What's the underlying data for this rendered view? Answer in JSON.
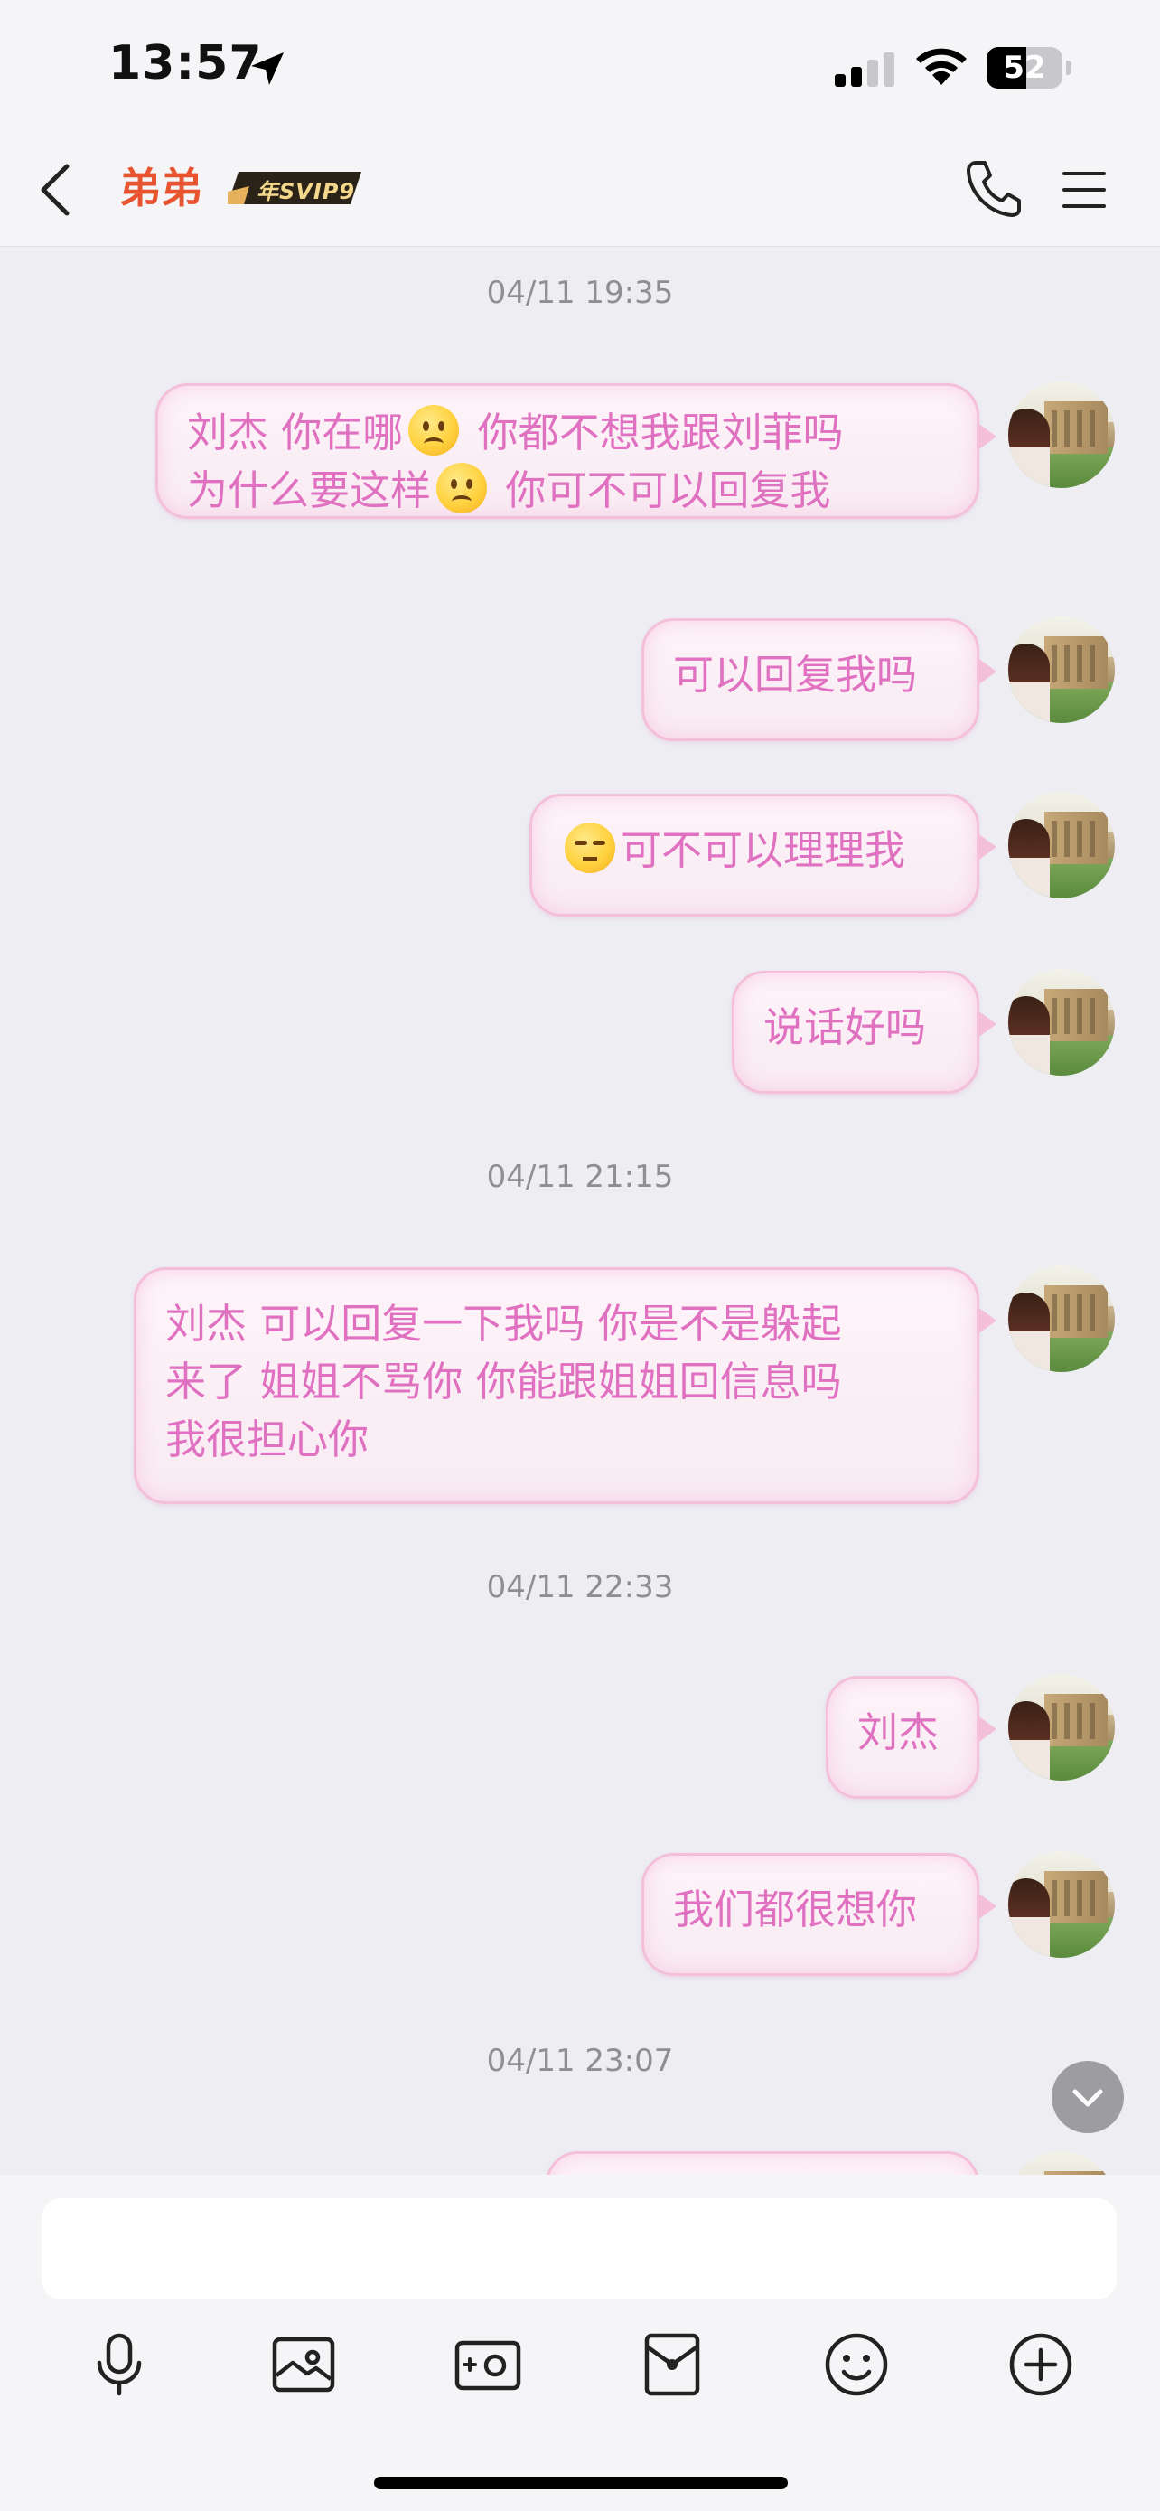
{
  "status_bar": {
    "time": "13:57",
    "battery_level": "52",
    "battery_fraction": 0.52
  },
  "header": {
    "title": "弟弟",
    "vip_badge": "年SVIP9",
    "back_icon": "chevron-left-icon",
    "call_icon": "phone-icon",
    "menu_icon": "menu-icon"
  },
  "messages": [
    {
      "type": "time",
      "text": "04/11 19:35"
    },
    {
      "type": "msg",
      "text_1": "刘杰 你在哪",
      "emoji_1": "slightly-frowning-face",
      "text_2": " 你都不想我跟刘菲吗\n为什么要这样",
      "emoji_2": "slightly-frowning-face",
      "text_3": " 你可不可以回复我"
    },
    {
      "type": "msg",
      "text": "可以回复我吗"
    },
    {
      "type": "msg",
      "emoji": "unamused-face",
      "text": "可不可以理理我"
    },
    {
      "type": "msg",
      "text": "说话好吗"
    },
    {
      "type": "time",
      "text": "04/11 21:15"
    },
    {
      "type": "msg",
      "text": "刘杰 可以回复一下我吗 你是不是躲起\n来了 姐姐不骂你 你能跟姐姐回信息吗\n我很担心你"
    },
    {
      "type": "time",
      "text": "04/11 22:33"
    },
    {
      "type": "msg",
      "text": "刘杰"
    },
    {
      "type": "msg",
      "text": "我们都很想你"
    },
    {
      "type": "time",
      "text": "04/11 23:07"
    }
  ],
  "scroll_button_icon": "chevron-down-icon",
  "input": {
    "value": "",
    "placeholder": ""
  },
  "toolbar": [
    "microphone-icon",
    "image-icon",
    "camera-icon",
    "red-packet-icon",
    "emoji-icon",
    "plus-circle-icon"
  ],
  "colors": {
    "bubble_text": "#e070c0",
    "bubble_border": "#f3bfd9",
    "title": "#e8542f",
    "background": "#ededf2"
  }
}
